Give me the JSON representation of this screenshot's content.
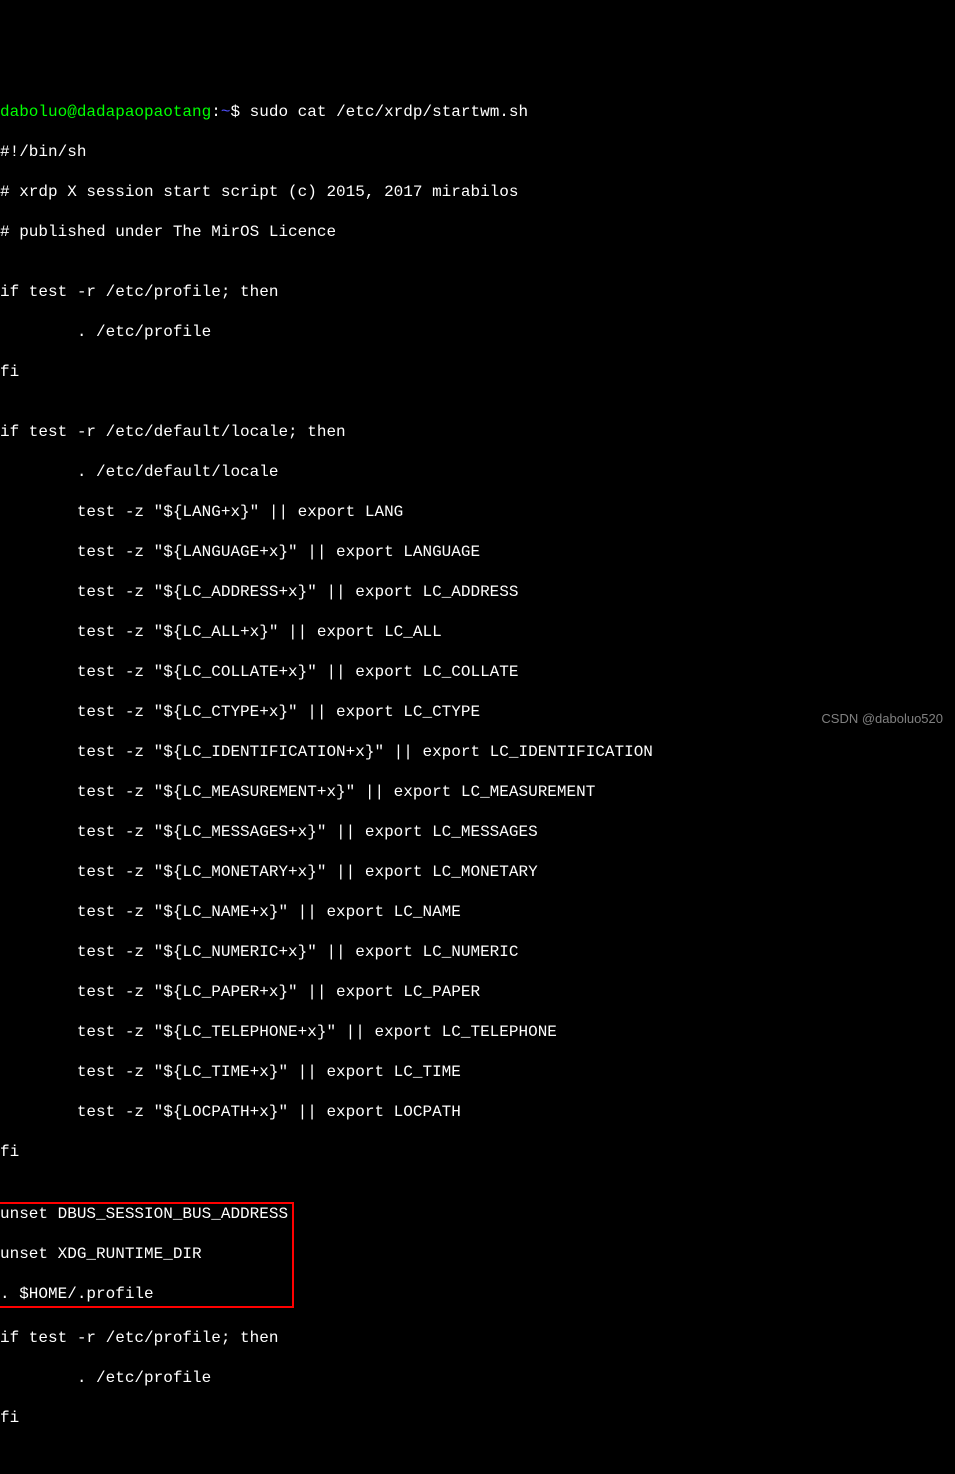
{
  "prompt": {
    "user": "daboluo@dadapaopaotang",
    "colon": ":",
    "path": "~",
    "dollar": "$ "
  },
  "command": "sudo cat /etc/xrdp/startwm.sh",
  "output": {
    "l1": "#!/bin/sh",
    "l2": "# xrdp X session start script (c) 2015, 2017 mirabilos",
    "l3": "# published under The MirOS Licence",
    "l4": "",
    "l5": "if test -r /etc/profile; then",
    "l6": "        . /etc/profile",
    "l7": "fi",
    "l8": "",
    "l9": "if test -r /etc/default/locale; then",
    "l10": "        . /etc/default/locale",
    "l11": "        test -z \"${LANG+x}\" || export LANG",
    "l12": "        test -z \"${LANGUAGE+x}\" || export LANGUAGE",
    "l13": "        test -z \"${LC_ADDRESS+x}\" || export LC_ADDRESS",
    "l14": "        test -z \"${LC_ALL+x}\" || export LC_ALL",
    "l15": "        test -z \"${LC_COLLATE+x}\" || export LC_COLLATE",
    "l16": "        test -z \"${LC_CTYPE+x}\" || export LC_CTYPE",
    "l17": "        test -z \"${LC_IDENTIFICATION+x}\" || export LC_IDENTIFICATION",
    "l18": "        test -z \"${LC_MEASUREMENT+x}\" || export LC_MEASUREMENT",
    "l19": "        test -z \"${LC_MESSAGES+x}\" || export LC_MESSAGES",
    "l20": "        test -z \"${LC_MONETARY+x}\" || export LC_MONETARY",
    "l21": "        test -z \"${LC_NAME+x}\" || export LC_NAME",
    "l22": "        test -z \"${LC_NUMERIC+x}\" || export LC_NUMERIC",
    "l23": "        test -z \"${LC_PAPER+x}\" || export LC_PAPER",
    "l24": "        test -z \"${LC_TELEPHONE+x}\" || export LC_TELEPHONE",
    "l25": "        test -z \"${LC_TIME+x}\" || export LC_TIME",
    "l26": "        test -z \"${LOCPATH+x}\" || export LOCPATH",
    "l27": "fi",
    "l28": "",
    "h1": "unset DBUS_SESSION_BUS_ADDRESS",
    "h2": "unset XDG_RUNTIME_DIR",
    "h3": ". $HOME/.profile",
    "l29": "",
    "l30": "if test -r /etc/profile; then",
    "l31": "        . /etc/profile",
    "l32": "fi"
  },
  "watermark": "CSDN @daboluo520"
}
